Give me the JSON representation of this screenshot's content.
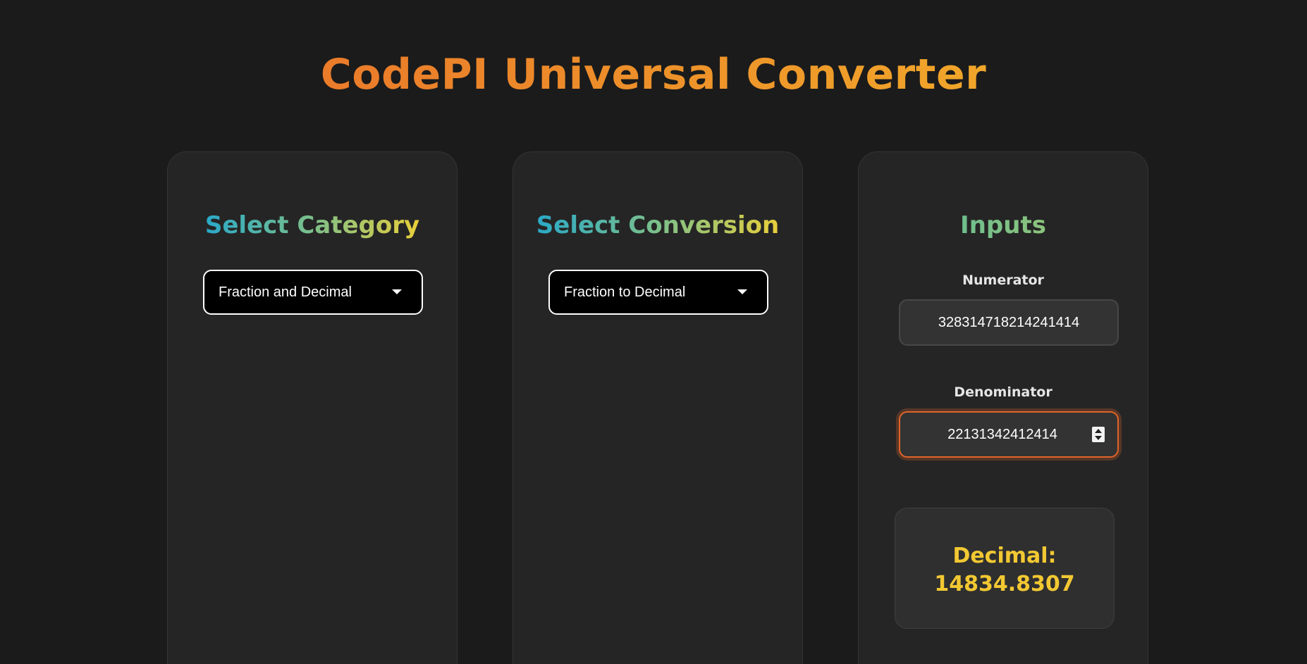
{
  "app": {
    "title": "CodePI Universal Converter"
  },
  "category_panel": {
    "heading": "Select Category",
    "selected": "Fraction and Decimal"
  },
  "conversion_panel": {
    "heading": "Select Conversion",
    "selected": "Fraction to Decimal"
  },
  "inputs_panel": {
    "heading": "Inputs",
    "numerator_label": "Numerator",
    "numerator_value": "328314718214241414",
    "denominator_label": "Denominator",
    "denominator_value": "22131342412414",
    "result_label": "Decimal:",
    "result_value": "14834.8307"
  },
  "colors": {
    "background": "#1b1b1b",
    "panel": "#252525",
    "title_gradient_start": "#ea7b2a",
    "title_gradient_end": "#f0a62a",
    "focus_border": "#e0652a",
    "result_text": "#f2c832"
  },
  "icons": {
    "select_arrow": "chevron-down-icon",
    "number_spinner": "spinner-icon"
  }
}
